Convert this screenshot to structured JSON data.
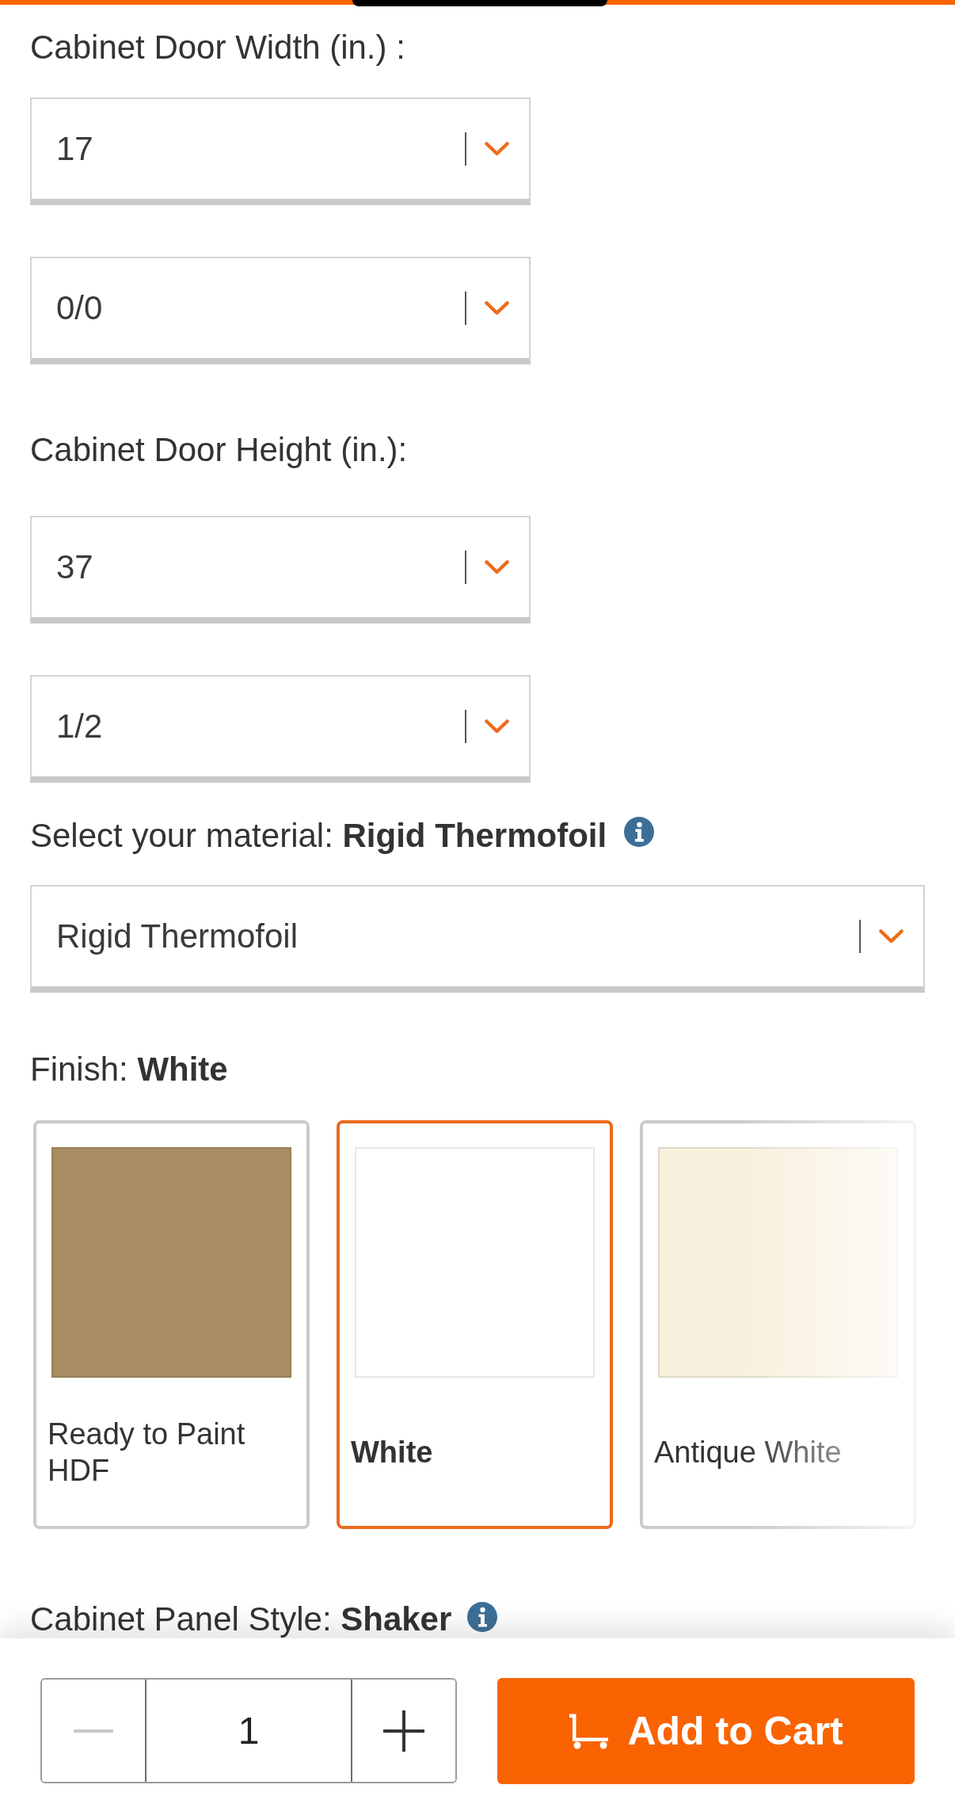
{
  "door_width": {
    "label": "Cabinet Door Width (in.) :",
    "dropdowns": [
      {
        "value": "17"
      },
      {
        "value": "0/0"
      }
    ]
  },
  "door_height": {
    "label": "Cabinet Door Height (in.):",
    "dropdowns": [
      {
        "value": "37"
      },
      {
        "value": "1/2"
      }
    ]
  },
  "material": {
    "label": "Select your material: **Rigid Thermofoil**",
    "dropdown": {
      "value": "Rigid Thermofoil"
    }
  },
  "finish": {
    "label": "Finish: **White**",
    "options": [
      {
        "label": "Ready to Paint HDF",
        "selected": false,
        "color": "#a88c62"
      },
      {
        "label": "White",
        "selected": true,
        "color": "#ffffff"
      },
      {
        "label": "Antique White",
        "selected": false,
        "color": "#f7f0dd"
      }
    ]
  },
  "panel_style": {
    "label": "Cabinet Panel Style: **Shaker**"
  },
  "footer": {
    "quantity": {
      "value": "1",
      "decrement_disabled": true
    },
    "add_to_cart": {
      "label": "Add to Cart"
    }
  }
}
